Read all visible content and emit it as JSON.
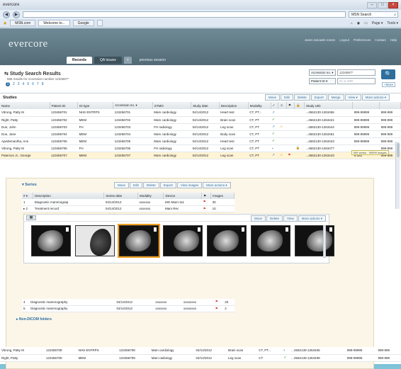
{
  "browser": {
    "title": "evercore",
    "address": "",
    "search_placeholder": "MSN Search",
    "tabs": [
      "MSN.com",
      "Welcome to...",
      "Google"
    ],
    "tools": [
      "Page ▾",
      "Tools ▾"
    ]
  },
  "app": {
    "logo_left": "evercore",
    "toplinks": [
      "Janet Janowitz-Jones",
      "Logout",
      "Preferences",
      "Contact",
      "Help"
    ],
    "tabs": [
      "Records",
      "QA Issues",
      "+",
      "previous session"
    ]
  },
  "search": {
    "title": "Study Search Results",
    "subtitle": "555 results for Accession number 1234567*",
    "pages": [
      "1",
      "2",
      "3",
      "4",
      "5",
      "6",
      "7",
      "8"
    ],
    "filter1_field": "Accession no. ▾",
    "filter1_value": "1234567*",
    "filter2_field": "Patient ID ▾",
    "filter2_value": "ID or MRI",
    "button": "🔍",
    "more": "+More"
  },
  "studies": {
    "label": "Studies",
    "actions": [
      "Move",
      "Edit",
      "Delete",
      "Export",
      "Merge",
      "View ▾",
      "More actions ▾"
    ],
    "columns": [
      "Name",
      "Patient ID",
      "ID type",
      "Accession no. ▾",
      "STMO",
      "Study date",
      "Description",
      "Modality",
      "✓",
      "⚠",
      "⚑",
      "🔒",
      "Study UID",
      "",
      ""
    ],
    "rows": [
      [
        "Vitrong, Patty M",
        "123456701",
        "NHS ENTRPS",
        "123456701",
        "Mam cardiology",
        "04/14/2012",
        "Heart test",
        "CT, PT...",
        "↗",
        "",
        "",
        "",
        "...4562130-1263456",
        "999-99999",
        "999-999"
      ],
      [
        "Right, Patty",
        "123456702",
        "MEM",
        "123456702",
        "Mam cardiology",
        "04/14/2012",
        "Brain scan",
        "CT, PT",
        "✓",
        "",
        "",
        "",
        "...4562130-1263421",
        "999-99999",
        "999-999"
      ],
      [
        "Doe, John",
        "123456703",
        "FH",
        "123456703",
        "FH radiology",
        "04/14/2012",
        "Leg scan",
        "CT, PT",
        "↗",
        "⚠",
        "",
        "",
        "...4562130-1263444",
        "999-99999",
        "999-999"
      ],
      [
        "Doe, Jane",
        "123456704",
        "MEM",
        "123456704",
        "Mam cardiology",
        "04/14/2012",
        "Body scan",
        "CT, PT",
        "✓",
        "",
        "",
        "",
        "...4562130-1263451",
        "999-99999",
        "999-999"
      ],
      [
        "Apedemantha, Ann",
        "123456705",
        "MEM",
        "123456705",
        "Mam cardiology",
        "04/14/2012",
        "Heart test",
        "CT, PT",
        "✓",
        "",
        "",
        "",
        "...4562130-1263423",
        "999-99999",
        "999-999"
      ],
      [
        "Vitrong, Patty M",
        "123456706",
        "FH",
        "123456706",
        "FH radiology",
        "04/14/2012",
        "Leg scan",
        "CT, PT",
        "•",
        "",
        "",
        "🔒",
        "...4562130-1263477",
        "999-99999",
        "999-999"
      ],
      [
        "Paterson Jr., George",
        "123456707",
        "MEM",
        "123456707",
        "Mam cardiology",
        "04/14/2012",
        "Leg scan",
        "CT, PT",
        "↗",
        "⚠",
        "⚑",
        "",
        "...4562130-1263443",
        "5-262",
        "999-999"
      ]
    ],
    "tooltip": "999 series · 99999 images"
  },
  "series": {
    "title": "Series",
    "actions": [
      "Move",
      "Edit",
      "Delete",
      "Export",
      "View images",
      "More actions ▾"
    ],
    "columns": [
      "# ▾",
      "Description",
      "Series date",
      "Modality",
      "Device",
      "⚑",
      "Images"
    ],
    "rows": [
      [
        "1",
        "Diagnostic mammograp",
        "04/14/2012",
        "xxxxxxx",
        "MG-Mam-111",
        "⚑",
        "30"
      ],
      [
        "▸ 2",
        "Treatment record",
        "04/14/2012",
        "xxxxxxx",
        "Mam Rec",
        "⚑",
        "10"
      ],
      [
        "▾ 3",
        "Diagnostic mammography",
        "04/14/2012",
        "xxxxxxx",
        "xxxxxxxx",
        "⚑",
        "200"
      ]
    ],
    "rows_after": [
      [
        "4",
        "Diagnostic mammography",
        "04/14/2012",
        "xxxxxxx",
        "xxxxxxxx",
        "⚑",
        "20"
      ],
      [
        "5",
        "Diagnostic mammography",
        "04/14/2012",
        "xxxxxxx",
        "xxxxxxxx",
        "⚑",
        "2"
      ]
    ],
    "thumb_actions": [
      "Move",
      "Delete",
      "View",
      "More actions ▾"
    ],
    "nondicom": "▸ Non-DICOM folders"
  },
  "bottom_rows": [
    [
      "Vitrong, Patty M",
      "123456708",
      "NHS ENTRPS",
      "123456708",
      "Mam cardiology",
      "04/14/2012",
      "Brain scan",
      "CT, PT...",
      "•",
      "...4562130-1263465",
      "999-99999",
      "999-999"
    ],
    [
      "Right, Patty",
      "123456709",
      "MEM",
      "123456709",
      "Mam radiology",
      "04/14/2012",
      "Leg scan",
      "CT",
      "✓",
      "...4562130-1263499",
      "999-99999",
      "999-999"
    ]
  ],
  "colors": {
    "accent": "#2b6ea3",
    "header": "#5f7a86",
    "selected": "#fff4d6",
    "ok": "#3f9b2c"
  }
}
